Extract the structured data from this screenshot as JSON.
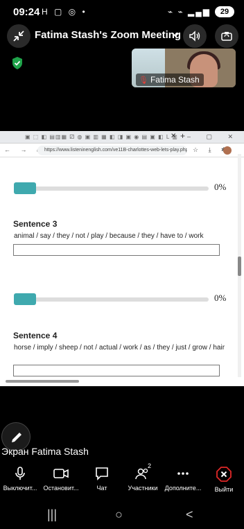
{
  "status_bar": {
    "time": "09:24",
    "left_icons": "H ▢ ◎ •",
    "right_icons": "⌁ ⌁ ▂▄▆",
    "battery": "29"
  },
  "meeting": {
    "title": "Fatima Stash's Zoom Meeting"
  },
  "video": {
    "participant_name": "Fatima Stash"
  },
  "browser": {
    "favicons": "▣ ⬚ ◧ ▤▥▦ ⚂ ◍ ▣ ▥ ▦ ◧ ◨ ▣ ◉ ▤ ▣ ◧ L ▥",
    "close_tab": "✕",
    "new_tab": "+",
    "window_controls": "– ▢ ✕",
    "nav_buttons": "← → ⌂",
    "url": "https://www.listeninenglish.com/ve11B-charlottes-web-lets-play.php",
    "address_icons": "☆ ⤓ ✱"
  },
  "exercise": {
    "progress_top": {
      "label": "0%",
      "value": 0
    },
    "sentence3": {
      "title": "Sentence 3",
      "words": "animal / say / they / not / play / because / they / have to / work",
      "answer": ""
    },
    "progress_mid": {
      "label": "0%",
      "value": 0
    },
    "sentence4": {
      "title": "Sentence 4",
      "words": "horse / imply / sheep / not / actual / work / as / they / just / grow / hair",
      "answer": ""
    }
  },
  "share_label": "Экран Fatima Stash",
  "toolbar": {
    "mute": "Выключит...",
    "video": "Остановит...",
    "chat": "Чат",
    "participants": "Участники",
    "participants_count": "2",
    "more": "Дополните...",
    "leave": "Выйти"
  },
  "colors": {
    "accent": "#3fa9ae",
    "leave": "#e02828",
    "shield": "#1fa34a"
  }
}
